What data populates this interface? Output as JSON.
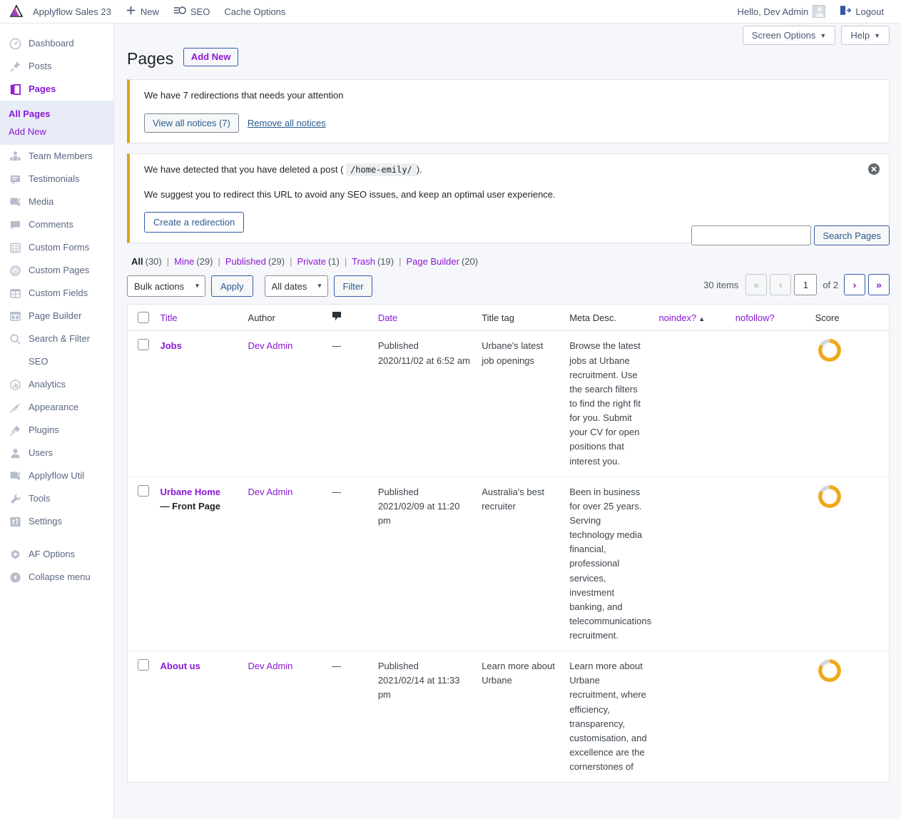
{
  "adminbar": {
    "logo_icon": "applyflow-logo-icon",
    "site_name": "Applyflow Sales 23",
    "new_label": "New",
    "new_icon": "plus-icon",
    "seo_label": "SEO",
    "seo_icon": "seo-sliders-icon",
    "cache_label": "Cache Options",
    "greeting": "Hello, Dev Admin",
    "logout_label": "Logout",
    "logout_icon": "logout-icon",
    "avatar_icon": "avatar-icon"
  },
  "sidebar": {
    "items": [
      {
        "label": "Dashboard",
        "icon": "dashboard-icon",
        "current": false
      },
      {
        "label": "Posts",
        "icon": "pin-icon",
        "current": false
      },
      {
        "label": "Pages",
        "icon": "pages-icon",
        "current": true
      },
      {
        "label": "Team Members",
        "icon": "team-icon",
        "current": false
      },
      {
        "label": "Testimonials",
        "icon": "testimonials-icon",
        "current": false
      },
      {
        "label": "Media",
        "icon": "media-icon",
        "current": false
      },
      {
        "label": "Comments",
        "icon": "comments-icon",
        "current": false
      },
      {
        "label": "Custom Forms",
        "icon": "forms-icon",
        "current": false
      },
      {
        "label": "Custom Pages",
        "icon": "custom-pages-icon",
        "current": false
      },
      {
        "label": "Custom Fields",
        "icon": "custom-fields-icon",
        "current": false
      },
      {
        "label": "Page Builder",
        "icon": "page-builder-icon",
        "current": false
      },
      {
        "label": "Search & Filter",
        "icon": "search-icon",
        "current": false
      },
      {
        "label": "SEO",
        "icon": "seo-icon",
        "current": false
      },
      {
        "label": "Analytics",
        "icon": "analytics-icon",
        "current": false
      },
      {
        "label": "Appearance",
        "icon": "appearance-icon",
        "current": false
      },
      {
        "label": "Plugins",
        "icon": "plugins-icon",
        "current": false
      },
      {
        "label": "Users",
        "icon": "users-icon",
        "current": false
      },
      {
        "label": "Applyflow Util",
        "icon": "applyflow-util-icon",
        "current": false
      },
      {
        "label": "Tools",
        "icon": "tools-icon",
        "current": false
      },
      {
        "label": "Settings",
        "icon": "settings-icon",
        "current": false
      }
    ],
    "submenu": [
      {
        "label": "All Pages",
        "active": true
      },
      {
        "label": "Add New",
        "active": false
      }
    ],
    "footer_items": [
      {
        "label": "AF Options",
        "icon": "gear-icon"
      },
      {
        "label": "Collapse menu",
        "icon": "collapse-icon"
      }
    ]
  },
  "header": {
    "screen_options_label": "Screen Options",
    "help_label": "Help",
    "caret": "▼",
    "page_title": "Pages",
    "add_new_label": "Add New"
  },
  "notices": [
    {
      "message": "We have 7 redirections that needs your attention",
      "button_label": "View all notices (7)",
      "link_label": "Remove all notices"
    },
    {
      "text_before": "We have detected that you have deleted a post (",
      "slug": "/home-emily/",
      "text_after": ").",
      "second_line": "We suggest you to redirect this URL to avoid any SEO issues, and keep an optimal user experience.",
      "button_label": "Create a redirection",
      "dismiss_icon": "close-icon"
    }
  ],
  "filters": {
    "links": [
      {
        "label": "All",
        "count": "(30)",
        "current": true
      },
      {
        "label": "Mine",
        "count": "(29)",
        "current": false
      },
      {
        "label": "Published",
        "count": "(29)",
        "current": false
      },
      {
        "label": "Private",
        "count": "(1)",
        "current": false
      },
      {
        "label": "Trash",
        "count": "(19)",
        "current": false
      },
      {
        "label": "Page Builder",
        "count": "(20)",
        "current": false
      }
    ],
    "separator": "|"
  },
  "search": {
    "value": "",
    "placeholder": "",
    "button_label": "Search Pages"
  },
  "tablenav": {
    "bulk_actions_value": "Bulk actions",
    "apply_label": "Apply",
    "dates_value": "All dates",
    "filter_label": "Filter",
    "items_count": "30 items",
    "first_icon": "«",
    "prev_icon": "‹",
    "current_page": "1",
    "of_label": "of 2",
    "next_icon": "›",
    "last_icon": "»"
  },
  "table": {
    "columns": [
      {
        "label": "Title",
        "link": true,
        "sorted": false
      },
      {
        "label": "Author",
        "link": false,
        "sorted": false
      },
      {
        "label": "",
        "link": false,
        "sorted": false,
        "icon": "comment-icon"
      },
      {
        "label": "Date",
        "link": true,
        "sorted": false
      },
      {
        "label": "Title tag",
        "link": false,
        "sorted": false
      },
      {
        "label": "Meta Desc.",
        "link": false,
        "sorted": false
      },
      {
        "label": "noindex?",
        "link": true,
        "sorted": true,
        "sort_arrow": "▲"
      },
      {
        "label": "nofollow?",
        "link": true,
        "sorted": false
      },
      {
        "label": "Score",
        "link": false,
        "sorted": false
      }
    ],
    "rows": [
      {
        "title": "Jobs",
        "front_page": "",
        "author": "Dev Admin",
        "comments": "—",
        "date_status": "Published",
        "date_value": "2020/11/02 at 6:52 am",
        "title_tag": "Urbane's latest job openings",
        "meta_desc": "Browse the latest jobs at Urbane recruitment. Use the search filters to find the right fit for you. Submit your CV for open positions that interest you.",
        "noindex": "",
        "nofollow": "",
        "score_color": "#f0a818",
        "score_track": "#d3d6da"
      },
      {
        "title": "Urbane Home",
        "front_page": "— Front Page",
        "author": "Dev Admin",
        "comments": "—",
        "date_status": "Published",
        "date_value": "2021/02/09 at 11:20 pm",
        "title_tag": "Australia's best recruiter",
        "meta_desc": "Been in business for over 25 years. Serving technology media financial, professional services, investment banking, and telecommunications recruitment.",
        "noindex": "",
        "nofollow": "",
        "score_color": "#f0a818",
        "score_track": "#d3d6da"
      },
      {
        "title": "About us",
        "front_page": "",
        "author": "Dev Admin",
        "comments": "—",
        "date_status": "Published",
        "date_value": "2021/02/14 at 11:33 pm",
        "title_tag": "Learn more about Urbane",
        "meta_desc": "Learn more about Urbane recruitment, where efficiency, transparency, customisation, and excellence are the cornerstones of",
        "noindex": "",
        "nofollow": "",
        "score_color": "#f0a818",
        "score_track": "#d3d6da"
      }
    ]
  },
  "colors": {
    "accent_purple": "#8b17d4",
    "link_blue": "#2a5b8f",
    "notice_border": "#dba617",
    "score_orange": "#f0a818"
  }
}
